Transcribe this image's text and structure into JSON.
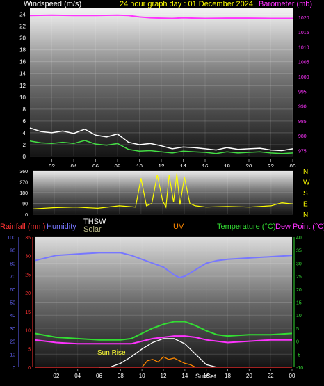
{
  "header": {
    "windspeed_label": "Windspeed (m/s)",
    "title": "24 hour graph day : 01 December 2024",
    "barometer_label": "Barometer (mb)"
  },
  "mid_header": {
    "rainfall_label": "Rainfall (mm)",
    "humidity_label": "Humidity",
    "thsw_label": "THSW",
    "solar_label": "Solar",
    "uv_label": "UV",
    "temperature_label": "Temperature (°C)",
    "dewpoint_label": "Dew Point (°C)"
  },
  "colors": {
    "windspeed": "#e0e0e0",
    "gust": "#ffffff",
    "wind_avg": "#44dd44",
    "barometer": "#ff33ff",
    "direction": "#ffff00",
    "rainfall": "#ff3333",
    "humidity": "#7777ff",
    "thsw": "#ffffff",
    "solar": "#ffff33",
    "uv": "#ff8800",
    "temperature": "#33dd33",
    "dewpoint": "#ff33ff",
    "axis_left": "#6666ff",
    "axis_red": "#ff3333",
    "axis_green": "#33dd33"
  },
  "chart_data": [
    {
      "type": "line",
      "name": "wind-barometer",
      "xlabel": "",
      "x_ticks": [
        "02",
        "04",
        "06",
        "08",
        "10",
        "12",
        "14",
        "16",
        "18",
        "20",
        "22",
        "00"
      ],
      "y_left": {
        "label": "Windspeed (m/s)",
        "min": 0,
        "max": 25,
        "ticks": [
          0,
          2,
          4,
          6,
          8,
          10,
          12,
          14,
          16,
          18,
          20,
          22,
          24
        ]
      },
      "y_right": {
        "label": "Barometer (mb)",
        "min": 973,
        "max": 1023,
        "ticks": [
          975,
          980,
          985,
          990,
          995,
          1000,
          1005,
          1010,
          1015,
          1020
        ]
      },
      "series": [
        {
          "key": "gust",
          "axis": "left",
          "x": [
            0,
            1,
            2,
            3,
            4,
            5,
            6,
            7,
            8,
            9,
            10,
            11,
            12,
            13,
            14,
            15,
            16,
            17,
            18,
            19,
            20,
            21,
            22,
            23,
            24
          ],
          "y": [
            4.8,
            4.2,
            4.0,
            4.3,
            3.9,
            4.6,
            3.6,
            3.3,
            3.8,
            2.4,
            2.0,
            2.2,
            1.8,
            1.3,
            1.6,
            1.5,
            1.3,
            1.1,
            1.5,
            1.2,
            1.3,
            1.4,
            1.1,
            1.0,
            1.3
          ]
        },
        {
          "key": "wind_avg",
          "axis": "left",
          "x": [
            0,
            1,
            2,
            3,
            4,
            5,
            6,
            7,
            8,
            9,
            10,
            11,
            12,
            13,
            14,
            15,
            16,
            17,
            18,
            19,
            20,
            21,
            22,
            23,
            24
          ],
          "y": [
            2.6,
            2.3,
            2.2,
            2.4,
            2.2,
            2.7,
            2.1,
            1.9,
            2.2,
            1.2,
            0.9,
            1.0,
            0.8,
            0.6,
            0.9,
            0.8,
            0.7,
            0.5,
            0.8,
            0.6,
            0.7,
            0.8,
            0.6,
            0.5,
            0.6
          ]
        },
        {
          "key": "barometer",
          "axis": "right",
          "x": [
            0,
            2,
            4,
            6,
            8,
            9,
            10,
            11,
            12,
            13,
            14,
            15,
            16,
            18,
            20,
            22,
            24
          ],
          "y": [
            1020.6,
            1020.7,
            1020.6,
            1020.6,
            1020.7,
            1020.6,
            1020.1,
            1019.8,
            1019.7,
            1019.6,
            1019.8,
            1019.7,
            1019.6,
            1019.7,
            1019.7,
            1019.6,
            1019.6
          ]
        }
      ]
    },
    {
      "type": "scatter",
      "name": "wind-direction",
      "x_ticks": [
        "02",
        "04",
        "06",
        "08",
        "10",
        "12",
        "14",
        "16",
        "18",
        "20",
        "22",
        "00"
      ],
      "y_left": {
        "min": 0,
        "max": 360,
        "ticks": [
          0,
          90,
          180,
          270,
          360
        ]
      },
      "y_right_labels": [
        "N",
        "W",
        "S",
        "E",
        "N"
      ],
      "series": [
        {
          "key": "direction",
          "x": [
            0,
            2,
            4,
            6,
            8,
            9.5,
            10,
            10.5,
            11,
            11.5,
            12,
            12.3,
            12.6,
            13,
            13.3,
            13.6,
            14,
            14.5,
            15,
            16,
            18,
            20,
            22,
            23,
            24
          ],
          "y": [
            45,
            55,
            60,
            50,
            70,
            60,
            300,
            70,
            90,
            330,
            110,
            60,
            330,
            100,
            340,
            80,
            310,
            90,
            70,
            60,
            65,
            60,
            70,
            95,
            85
          ]
        }
      ]
    },
    {
      "type": "line",
      "name": "temp-humidity",
      "x_ticks": [
        "02",
        "04",
        "06",
        "08",
        "10",
        "12",
        "14",
        "16",
        "18",
        "20",
        "22",
        "00"
      ],
      "y_left": {
        "label": "Humidity",
        "min": 0,
        "max": 100,
        "ticks": [
          0,
          10,
          20,
          30,
          40,
          50,
          60,
          70,
          80,
          90,
          100
        ]
      },
      "y_left2": {
        "label": "Rainfall (mm)",
        "min": 0,
        "max": 35,
        "ticks": [
          0,
          5,
          10,
          15,
          20,
          25,
          30,
          35
        ]
      },
      "y_right": {
        "label": "Temperature (°C)",
        "min": -10,
        "max": 40,
        "ticks": [
          -10,
          -5,
          0,
          5,
          10,
          15,
          20,
          25,
          30,
          35,
          40
        ]
      },
      "annotations": [
        "Sun Rise",
        "SunSet"
      ],
      "series": [
        {
          "key": "humidity",
          "axis": "left",
          "x": [
            0,
            2,
            4,
            6,
            8,
            9,
            10,
            11,
            12,
            13,
            13.5,
            14,
            15,
            16,
            17,
            18,
            20,
            22,
            24
          ],
          "y": [
            82,
            86,
            87,
            88,
            88,
            86,
            83,
            80,
            77,
            71,
            69,
            70,
            75,
            80,
            82,
            83,
            84,
            85,
            86
          ]
        },
        {
          "key": "temperature",
          "axis": "right",
          "x": [
            0,
            2,
            4,
            6,
            8,
            9,
            10,
            11,
            12,
            13,
            14,
            15,
            16,
            17,
            18,
            20,
            22,
            24
          ],
          "y": [
            3,
            1.5,
            1,
            0.5,
            0.5,
            1,
            3,
            5,
            6.5,
            7.5,
            7.5,
            6,
            4,
            2.5,
            2,
            2.5,
            2.5,
            3
          ]
        },
        {
          "key": "dewpoint",
          "axis": "right",
          "x": [
            0,
            2,
            4,
            6,
            8,
            9,
            10,
            11,
            12,
            13,
            14,
            15,
            16,
            17,
            18,
            20,
            22,
            24
          ],
          "y": [
            0.5,
            -0.5,
            -1,
            -1,
            -1,
            -1,
            0,
            1,
            1.5,
            2,
            2,
            1.5,
            0.5,
            0,
            -0.5,
            0,
            0.5,
            0.5
          ]
        },
        {
          "key": "thsw",
          "axis": "right",
          "x": [
            6,
            7,
            8,
            9,
            10,
            11,
            12,
            13,
            14,
            15,
            16,
            17
          ],
          "y": [
            -10,
            -10,
            -8.5,
            -6,
            -3,
            -0.5,
            1,
            1,
            -1,
            -5,
            -9,
            -10
          ]
        },
        {
          "key": "uv",
          "axis": "left",
          "x": [
            10,
            10.5,
            11,
            11.5,
            12,
            12.5,
            13,
            13.5,
            14,
            14.5,
            15
          ],
          "y": [
            0,
            5,
            6,
            4,
            8,
            6,
            7,
            5,
            3,
            2,
            0
          ]
        },
        {
          "key": "rainfall",
          "axis": "left2",
          "x": [
            0,
            24
          ],
          "y": [
            0,
            0
          ]
        }
      ]
    }
  ]
}
